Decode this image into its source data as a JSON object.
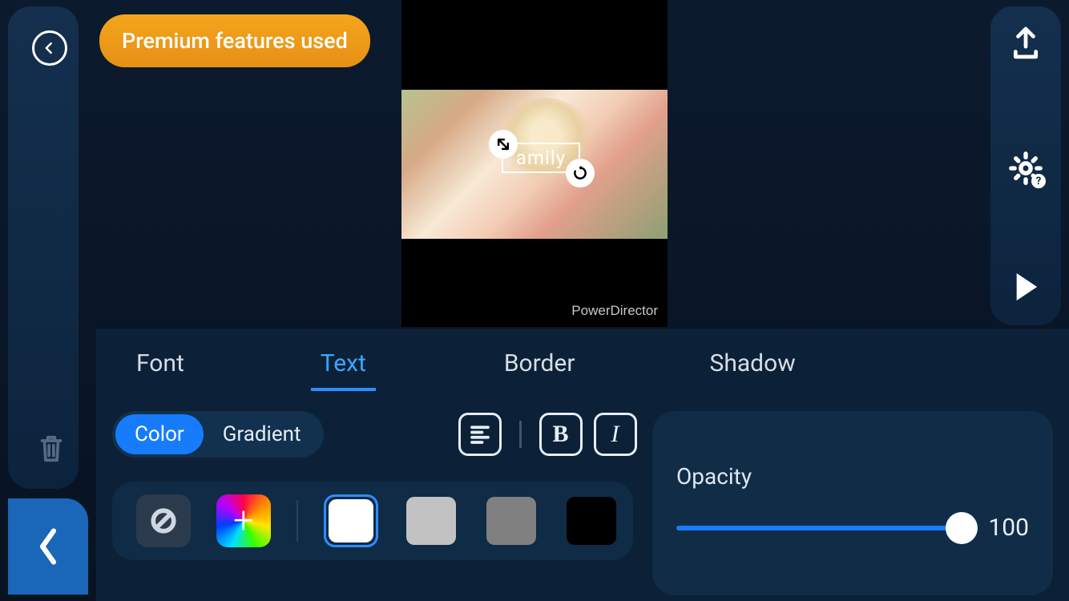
{
  "premium_banner": "Premium features used",
  "preview": {
    "text_value": "amily",
    "watermark": "PowerDirector"
  },
  "tabs": [
    "Font",
    "Text",
    "Border",
    "Shadow"
  ],
  "tabs_active_index": 1,
  "fill_mode": {
    "options": [
      "Color",
      "Gradient"
    ],
    "active_index": 0
  },
  "swatches": {
    "colors": [
      "#ffffff",
      "#c2c2c2",
      "#808080",
      "#000000"
    ],
    "selected_index": 0
  },
  "opacity": {
    "label": "Opacity",
    "value": 100,
    "min": 0,
    "max": 100
  },
  "icons": {
    "back": "back-icon",
    "trash": "trash-icon",
    "chevron_left": "chevron-left-icon",
    "export": "export-icon",
    "settings": "gear-icon",
    "help_badge": "?",
    "play": "play-icon",
    "align_left": "align-left-icon",
    "bold": "B",
    "italic": "I",
    "resize": "resize-handle-icon",
    "rotate": "rotate-handle-icon",
    "no_color": "no-color-icon",
    "color_picker": "color-picker-icon"
  }
}
